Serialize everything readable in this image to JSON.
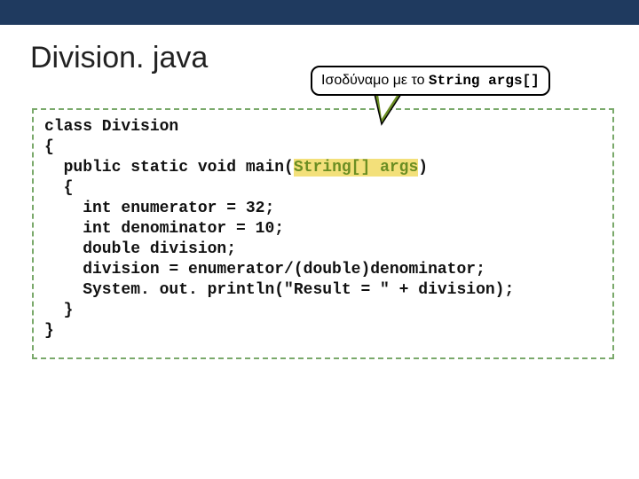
{
  "title": "Division. java",
  "callout_prefix": "Ισοδύναμο με το ",
  "callout_code": "String args[]",
  "code": {
    "l1": "class Division",
    "l2": "{",
    "l3a": "  public static void main(",
    "l3b": "String[] args",
    "l3c": ")",
    "l4": "  {",
    "l5": "    int enumerator = 32;",
    "l6": "    int denominator = 10;",
    "l7": "    double division;",
    "l8": "    division = enumerator/(double)denominator;",
    "l9": "    System. out. println(\"Result = \" + division);",
    "l10": "  }",
    "l11": "}"
  }
}
